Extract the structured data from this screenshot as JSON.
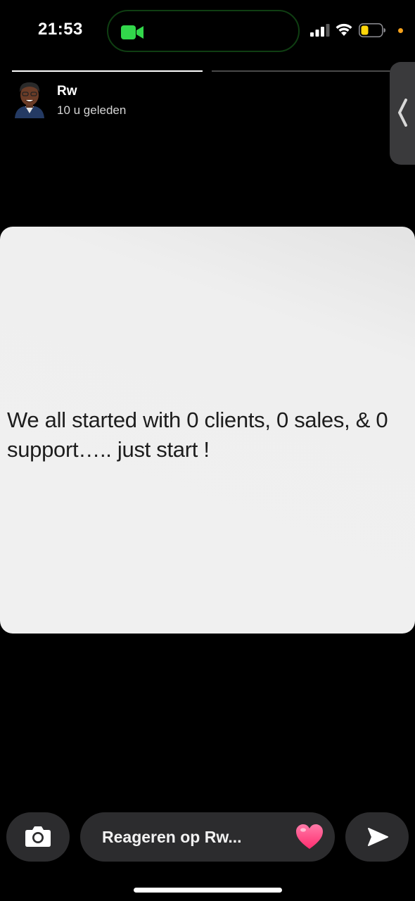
{
  "status_bar": {
    "time": "21:53",
    "facetime_color": "#32d74b",
    "battery_color": "#ffd60a",
    "indicator_color": "#f7a21b"
  },
  "progress": {
    "segments": 2,
    "current_segment": 1,
    "current_fill": 1.0
  },
  "header": {
    "username": "Rw",
    "time_ago": "10 u geleden",
    "avatar_icon": "bitmoji-avatar"
  },
  "story": {
    "text": "We all started with 0 clients, 0 sales, & 0 support….. just start !"
  },
  "bottom_bar": {
    "camera_icon": "camera-icon",
    "reply_placeholder": "Reageren op Rw...",
    "heart_icon": "heart-icon",
    "send_icon": "send-icon"
  }
}
